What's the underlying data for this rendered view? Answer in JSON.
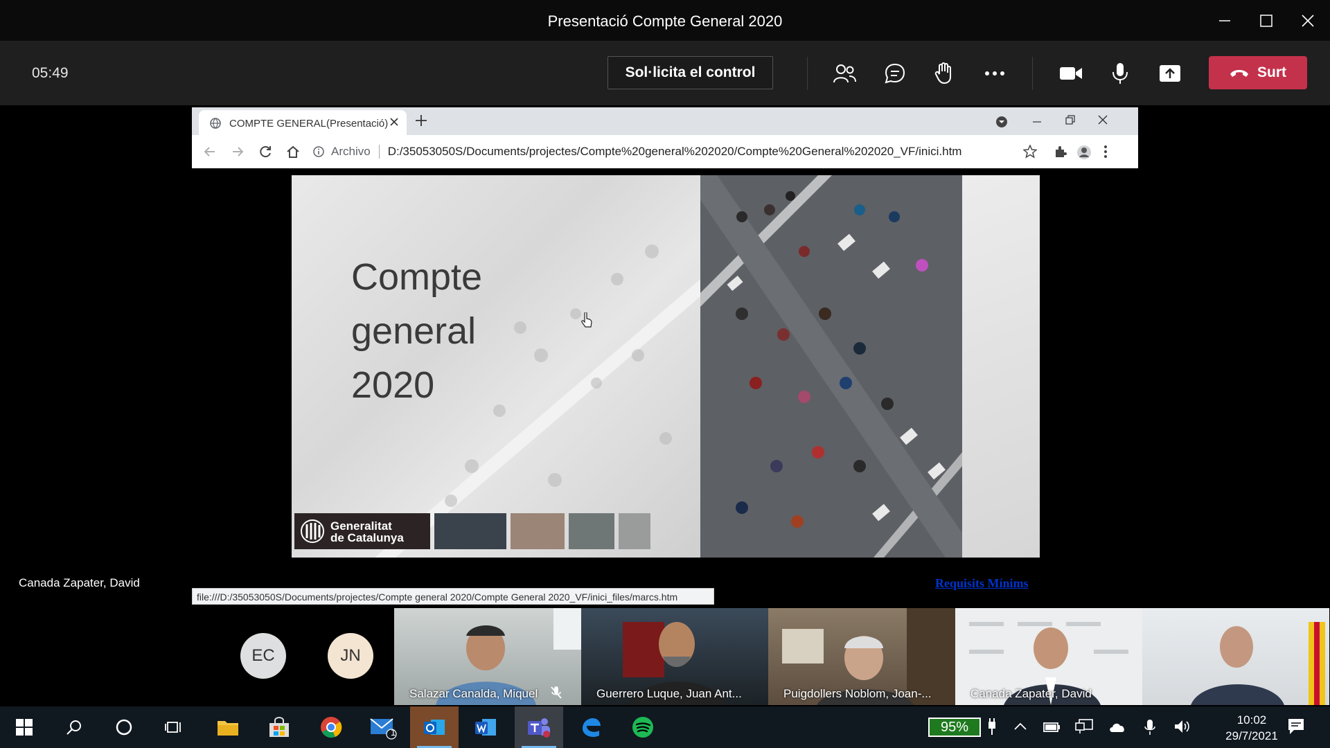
{
  "window": {
    "title": "Presentació Compte General 2020"
  },
  "meeting": {
    "timer": "05:49",
    "request_control_label": "Sol·licita el control",
    "leave_label": "Surt"
  },
  "browser": {
    "tab_title": "COMPTE GENERAL(Presentació)",
    "security_label": "Archivo",
    "url": "D:/35053050S/Documents/projectes/Compte%20general%202020/Compte%20General%202020_VF/inici.htm",
    "status_url": "file:///D:/35053050S/Documents/projectes/Compte general 2020/Compte General 2020_VF/inici_files/marcs.htm"
  },
  "slide": {
    "title_lines": [
      "Compte",
      "general",
      "2020"
    ],
    "logo_lines": [
      "Generalitat",
      "de Catalunya"
    ],
    "swatch_colors": [
      "#3a434b",
      "#9b8577",
      "#6f7676",
      "#9a9c9c"
    ]
  },
  "presenter_name": "Canada Zapater, David",
  "requirements_link": "Requisits Mínims",
  "participants": {
    "avatars": [
      {
        "initials": "EC",
        "color": "#dedfe0"
      },
      {
        "initials": "JN",
        "color": "#f4e5d2"
      }
    ],
    "videos": [
      {
        "name": "Salazar Canalda, Miquel",
        "muted": true
      },
      {
        "name": "Guerrero Luque, Juan Ant...",
        "muted": false
      },
      {
        "name": "Puigdollers Noblom, Joan-...",
        "muted": false
      },
      {
        "name": "Canada Zapater, David",
        "muted": false
      },
      {
        "name": "",
        "muted": false
      }
    ]
  },
  "taskbar": {
    "battery": "95%",
    "time": "10:02",
    "date": "29/7/2021",
    "mail_badge": "1"
  },
  "colors": {
    "leave": "#c4314b",
    "teams_bar": "#1f1f1f",
    "taskbar": "#101820"
  }
}
